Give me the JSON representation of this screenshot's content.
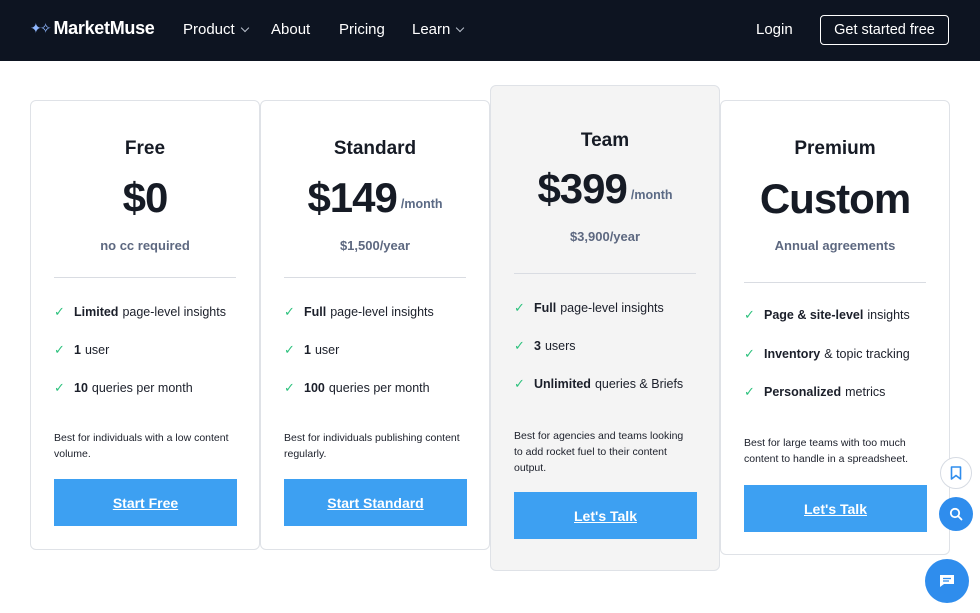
{
  "nav": {
    "brand": "MarketMuse",
    "items": [
      "Product",
      "About",
      "Pricing",
      "Learn"
    ],
    "login": "Login",
    "cta": "Get started free"
  },
  "plans": [
    {
      "name": "Free",
      "price": "$0",
      "per": "",
      "sub": "no cc required",
      "features": [
        {
          "bold": "Limited",
          "text": "page-level insights"
        },
        {
          "bold": "1",
          "text": "user"
        },
        {
          "bold": "10",
          "text": "queries per month"
        }
      ],
      "description": "Best for individuals with a low content volume.",
      "button": "Start Free"
    },
    {
      "name": "Standard",
      "price": "$149",
      "per": "/month",
      "sub": "$1,500/year",
      "features": [
        {
          "bold": "Full",
          "text": "page-level insights"
        },
        {
          "bold": "1",
          "text": "user"
        },
        {
          "bold": "100",
          "text": "queries per month"
        }
      ],
      "description": "Best for individuals publishing content regularly.",
      "button": "Start Standard"
    },
    {
      "name": "Team",
      "price": "$399",
      "per": "/month",
      "sub": "$3,900/year",
      "features": [
        {
          "bold": "Full",
          "text": "page-level insights"
        },
        {
          "bold": "3",
          "text": "users"
        },
        {
          "bold": "Unlimited",
          "text": "queries & Briefs"
        }
      ],
      "description": "Best for agencies and teams looking to add rocket fuel to their content output.",
      "button": "Let's Talk"
    },
    {
      "name": "Premium",
      "price": "Custom",
      "per": "",
      "sub": "Annual agreements",
      "features": [
        {
          "bold": "Page & site-level",
          "text": "insights"
        },
        {
          "bold": "Inventory",
          "text": "& topic tracking"
        },
        {
          "bold": "Personalized",
          "text": "metrics"
        }
      ],
      "description": "Best for large teams with too much content to handle in a spreadsheet.",
      "button": "Let's Talk"
    }
  ],
  "colors": {
    "nav_bg": "#0d1421",
    "accent": "#3da0f2",
    "check": "#2ec27e",
    "muted": "#5d6880"
  },
  "floating": {
    "bookmark_icon": "bookmark-icon",
    "search_icon": "search-icon",
    "chat_icon": "chat-icon"
  }
}
